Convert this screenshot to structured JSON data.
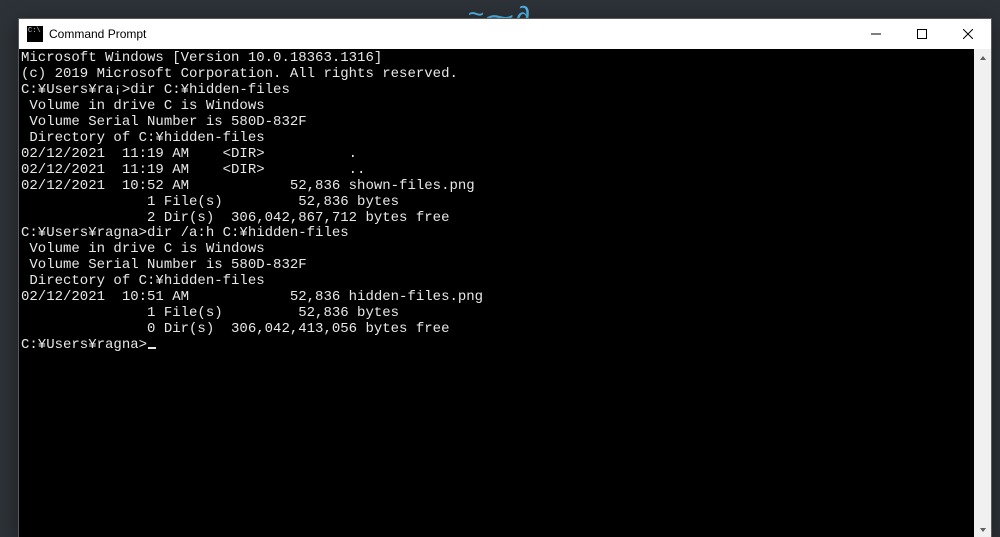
{
  "bg_decor": "≈⁓∂",
  "window": {
    "title": "Command Prompt"
  },
  "terminal": {
    "lines": [
      "Microsoft Windows [Version 10.0.18363.1316]",
      "(c) 2019 Microsoft Corporation. All rights reserved.",
      "",
      "C:¥Users¥ra¡>dir C:¥hidden-files",
      " Volume in drive C is Windows",
      " Volume Serial Number is 580D-832F",
      "",
      " Directory of C:¥hidden-files",
      "",
      "02/12/2021  11:19 AM    <DIR>          .",
      "02/12/2021  11:19 AM    <DIR>          ..",
      "02/12/2021  10:52 AM            52,836 shown-files.png",
      "               1 File(s)         52,836 bytes",
      "               2 Dir(s)  306,042,867,712 bytes free",
      "",
      "C:¥Users¥ragna>dir /a:h C:¥hidden-files",
      " Volume in drive C is Windows",
      " Volume Serial Number is 580D-832F",
      "",
      " Directory of C:¥hidden-files",
      "",
      "02/12/2021  10:51 AM            52,836 hidden-files.png",
      "               1 File(s)         52,836 bytes",
      "               0 Dir(s)  306,042,413,056 bytes free",
      "",
      "C:¥Users¥ragna>"
    ]
  }
}
